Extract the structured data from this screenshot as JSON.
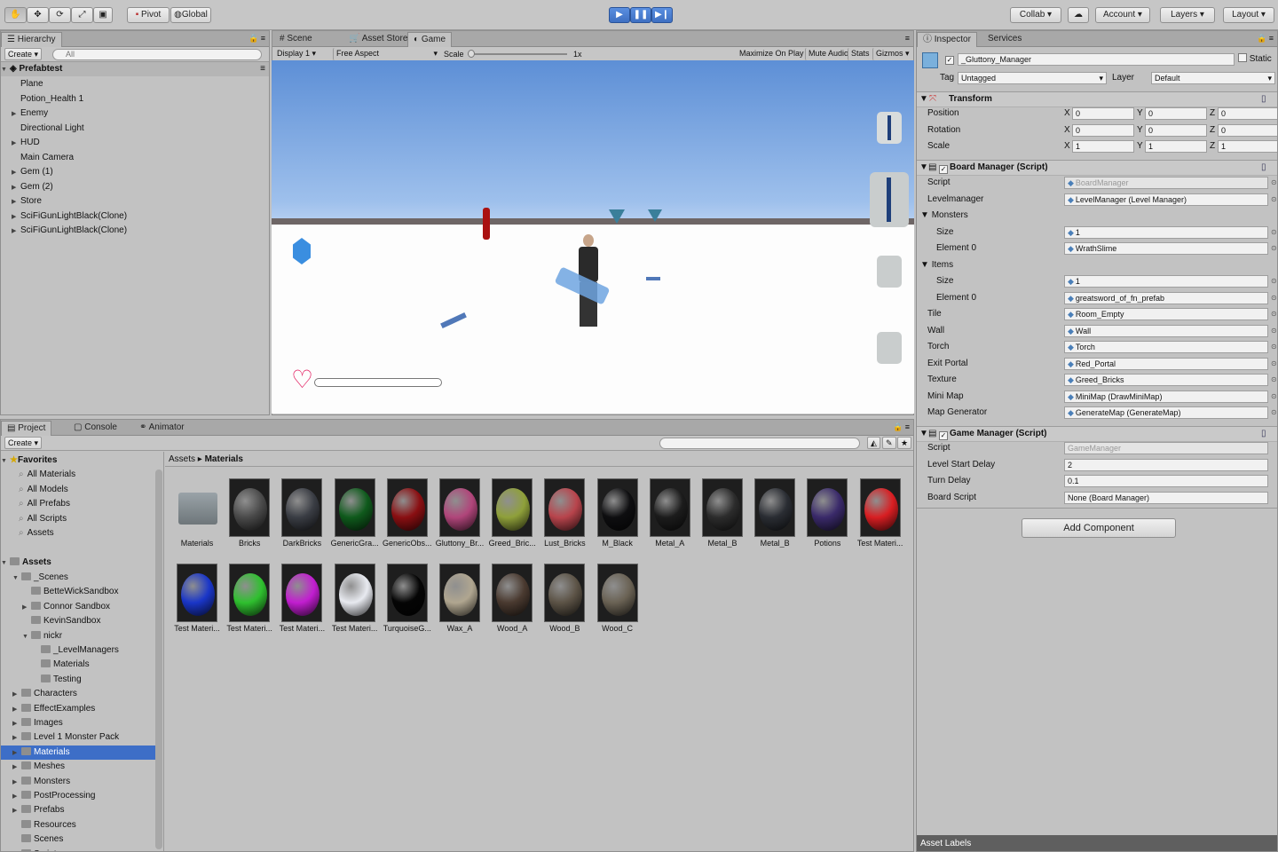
{
  "toolbar": {
    "pivot": "Pivot",
    "global": "Global",
    "collab": "Collab ▾",
    "account": "Account",
    "layers": "Layers",
    "layout": "Layout"
  },
  "hierarchy": {
    "tab": "Hierarchy",
    "create": "Create ▾",
    "search_placeholder": "All",
    "scene": "Prefabtest",
    "items": [
      {
        "label": "Plane",
        "arrow": ""
      },
      {
        "label": "Potion_Health 1",
        "arrow": ""
      },
      {
        "label": "Enemy",
        "arrow": "▶"
      },
      {
        "label": "Directional Light",
        "arrow": ""
      },
      {
        "label": "HUD",
        "arrow": "▶"
      },
      {
        "label": "Main Camera",
        "arrow": ""
      },
      {
        "label": "Gem (1)",
        "arrow": "▶"
      },
      {
        "label": "Gem (2)",
        "arrow": "▶"
      },
      {
        "label": "Store",
        "arrow": "▶"
      },
      {
        "label": "SciFiGunLightBlack(Clone)",
        "arrow": "▶"
      },
      {
        "label": "SciFiGunLightBlack(Clone)",
        "arrow": "▶"
      }
    ]
  },
  "scene_tabs": {
    "scene": "Scene",
    "asset_store": "Asset Store",
    "game": "Game"
  },
  "game_bar": {
    "display": "Display 1",
    "aspect": "Free Aspect",
    "scale_label": "Scale",
    "scale_value": "1x",
    "maximize": "Maximize On Play",
    "mute": "Mute Audio",
    "stats": "Stats",
    "gizmos": "Gizmos"
  },
  "project": {
    "tabs": {
      "project": "Project",
      "console": "Console",
      "animator": "Animator"
    },
    "create": "Create ▾",
    "breadcrumb_root": "Assets",
    "breadcrumb_current": "Materials",
    "favorites_title": "Favorites",
    "favorites": [
      "All Materials",
      "All Models",
      "All Prefabs",
      "All Scripts",
      "Assets"
    ],
    "assets_title": "Assets",
    "tree": [
      {
        "label": "_Scenes",
        "arrow": "▼",
        "indent": 1
      },
      {
        "label": "BetteWickSandbox",
        "arrow": "",
        "indent": 2
      },
      {
        "label": "Connor Sandbox",
        "arrow": "▶",
        "indent": 2
      },
      {
        "label": "KevinSandbox",
        "arrow": "",
        "indent": 2
      },
      {
        "label": "nickr",
        "arrow": "▼",
        "indent": 2
      },
      {
        "label": "_LevelManagers",
        "arrow": "",
        "indent": 3
      },
      {
        "label": "Materials",
        "arrow": "",
        "indent": 3
      },
      {
        "label": "Testing",
        "arrow": "",
        "indent": 3
      },
      {
        "label": "Characters",
        "arrow": "▶",
        "indent": 1
      },
      {
        "label": "EffectExamples",
        "arrow": "▶",
        "indent": 1
      },
      {
        "label": "Images",
        "arrow": "▶",
        "indent": 1
      },
      {
        "label": "Level 1 Monster Pack",
        "arrow": "▶",
        "indent": 1
      },
      {
        "label": "Materials",
        "arrow": "▶",
        "indent": 1,
        "selected": true
      },
      {
        "label": "Meshes",
        "arrow": "▶",
        "indent": 1
      },
      {
        "label": "Monsters",
        "arrow": "▶",
        "indent": 1
      },
      {
        "label": "PostProcessing",
        "arrow": "▶",
        "indent": 1
      },
      {
        "label": "Prefabs",
        "arrow": "▶",
        "indent": 1
      },
      {
        "label": "Resources",
        "arrow": "",
        "indent": 1
      },
      {
        "label": "Scenes",
        "arrow": "",
        "indent": 1
      },
      {
        "label": "Scripts",
        "arrow": "▶",
        "indent": 1
      }
    ],
    "materials": [
      {
        "name": "Materials",
        "color": "folder"
      },
      {
        "name": "Bricks",
        "color": "#4a4a4a"
      },
      {
        "name": "DarkBricks",
        "color": "#3a3d44"
      },
      {
        "name": "GenericGra...",
        "color": "#0f5a1c"
      },
      {
        "name": "GenericObs...",
        "color": "#8a0f12"
      },
      {
        "name": "Gluttony_Br...",
        "color": "#b0457a"
      },
      {
        "name": "Greed_Bric...",
        "color": "#8fa03a"
      },
      {
        "name": "Lust_Bricks",
        "color": "#b8444c"
      },
      {
        "name": "M_Black",
        "color": "#0e0e10"
      },
      {
        "name": "Metal_A",
        "color": "#1c1c1c"
      },
      {
        "name": "Metal_B",
        "color": "#2c2c2c"
      },
      {
        "name": "Metal_B",
        "color": "#2a2d33"
      },
      {
        "name": "Potions",
        "color": "#3a2a6a"
      },
      {
        "name": "Test Materi...",
        "color": "#d81e22"
      },
      {
        "name": "Test Materi...",
        "color": "#1a36c8"
      },
      {
        "name": "Test Materi...",
        "color": "#2fc02f"
      },
      {
        "name": "Test Materi...",
        "color": "#c21ed0"
      },
      {
        "name": "Test Materi...",
        "color": "#e8eaf0"
      },
      {
        "name": "TurquoiseG...",
        "color": "#050505"
      },
      {
        "name": "Wax_A",
        "color": "#b0a690"
      },
      {
        "name": "Wood_A",
        "color": "#4a3a30"
      },
      {
        "name": "Wood_B",
        "color": "#5c5346"
      },
      {
        "name": "Wood_C",
        "color": "#6a6254"
      }
    ]
  },
  "inspector": {
    "tabs": {
      "inspector": "Inspector",
      "services": "Services"
    },
    "object_name": "_Gluttony_Manager",
    "static": "Static",
    "tag_label": "Tag",
    "tag_value": "Untagged",
    "layer_label": "Layer",
    "layer_value": "Default",
    "transform": {
      "title": "Transform",
      "position": "Position",
      "rotation": "Rotation",
      "scale": "Scale",
      "pos": [
        "0",
        "0",
        "0"
      ],
      "rot": [
        "0",
        "0",
        "0"
      ],
      "scl": [
        "1",
        "1",
        "1"
      ]
    },
    "board": {
      "title": "Board Manager (Script)",
      "rows": [
        {
          "label": "Script",
          "value": "BoardManager",
          "dis": true,
          "indent": 0
        },
        {
          "label": "Levelmanager",
          "value": "LevelManager (Level Manager)",
          "indent": 0
        },
        {
          "label": "Monsters",
          "value": "",
          "indent": 0,
          "fold": true
        },
        {
          "label": "Size",
          "value": "1",
          "indent": 2
        },
        {
          "label": "Element 0",
          "value": "WrathSlime",
          "indent": 2
        },
        {
          "label": "Items",
          "value": "",
          "indent": 0,
          "fold": true
        },
        {
          "label": "Size",
          "value": "1",
          "indent": 2
        },
        {
          "label": "Element 0",
          "value": "greatsword_of_fn_prefab",
          "indent": 2
        },
        {
          "label": "Tile",
          "value": "Room_Empty",
          "indent": 0
        },
        {
          "label": "Wall",
          "value": "Wall",
          "indent": 0
        },
        {
          "label": "Torch",
          "value": "Torch",
          "indent": 0
        },
        {
          "label": "Exit Portal",
          "value": "Red_Portal",
          "indent": 0
        },
        {
          "label": "Texture",
          "value": "Greed_Bricks",
          "indent": 0
        },
        {
          "label": "Mini Map",
          "value": "MiniMap (DrawMiniMap)",
          "indent": 0
        },
        {
          "label": "Map Generator",
          "value": "GenerateMap (GenerateMap)",
          "indent": 0
        }
      ]
    },
    "game": {
      "title": "Game Manager (Script)",
      "rows": [
        {
          "label": "Script",
          "value": "GameManager",
          "dis": true
        },
        {
          "label": "Level Start Delay",
          "value": "2"
        },
        {
          "label": "Turn Delay",
          "value": "0.1"
        },
        {
          "label": "Board Script",
          "value": "None (Board Manager)"
        }
      ]
    },
    "add_component": "Add Component",
    "asset_labels": "Asset Labels"
  }
}
